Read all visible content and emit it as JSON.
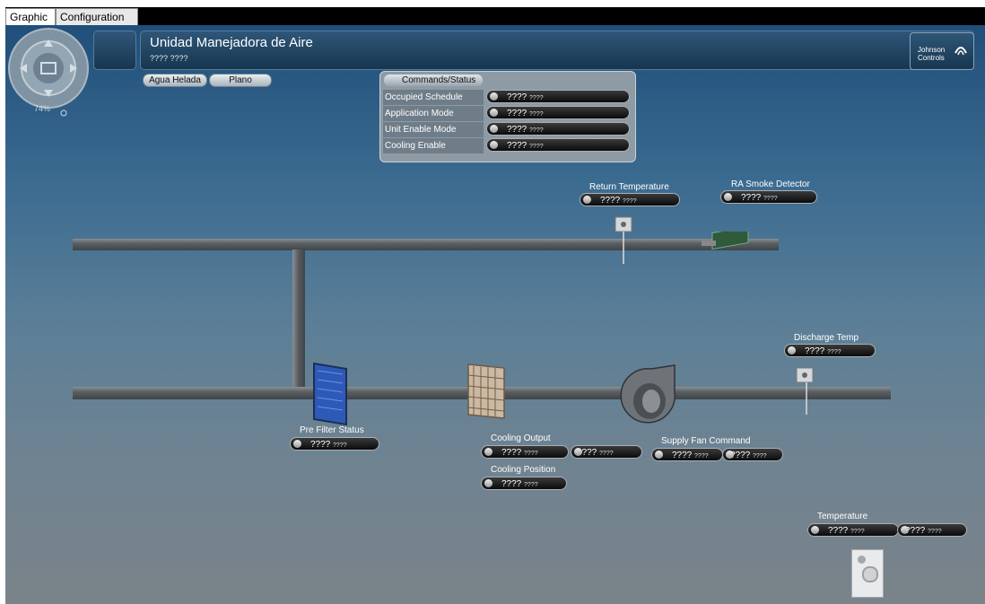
{
  "tabs": [
    {
      "label": "Graphic"
    },
    {
      "label": "Configuration"
    }
  ],
  "header": {
    "title": "Unidad Manejadora de Aire",
    "subtitle": "???? ????",
    "brand": "Johnson Controls"
  },
  "nav": {
    "zoom": "74%"
  },
  "quick_buttons": [
    {
      "label": "Agua Helada"
    },
    {
      "label": "Plano"
    }
  ],
  "commands": {
    "title": "Commands/Status",
    "rows": [
      {
        "label": "Occupied Schedule",
        "value": "????",
        "unit": "????"
      },
      {
        "label": "Application Mode",
        "value": "????",
        "unit": "????"
      },
      {
        "label": "Unit Enable Mode",
        "value": "????",
        "unit": "????"
      },
      {
        "label": "Cooling Enable",
        "value": "????",
        "unit": "????"
      }
    ]
  },
  "widgets": {
    "return_temp": {
      "label": "Return Temperature",
      "value": "????",
      "unit": "????"
    },
    "smoke": {
      "label": "RA Smoke Detector",
      "value": "????",
      "unit": "????"
    },
    "discharge": {
      "label": "Discharge Temp",
      "value": "????",
      "unit": "????"
    },
    "prefilter": {
      "label": "Pre Filter Status",
      "value": "????",
      "unit": "????"
    },
    "cooling_output": {
      "label": "Cooling Output",
      "value1": "????",
      "unit1": "????",
      "value2": "????",
      "unit2": "????"
    },
    "cooling_position": {
      "label": "Cooling Position",
      "value": "????",
      "unit": "????"
    },
    "supply_fan": {
      "label": "Supply Fan Command",
      "value1": "????",
      "unit1": "????",
      "value2": "????",
      "unit2": "????"
    },
    "temperature": {
      "label": "Temperature",
      "value1": "????",
      "unit1": "????",
      "value2": "????",
      "unit2": "????"
    }
  }
}
